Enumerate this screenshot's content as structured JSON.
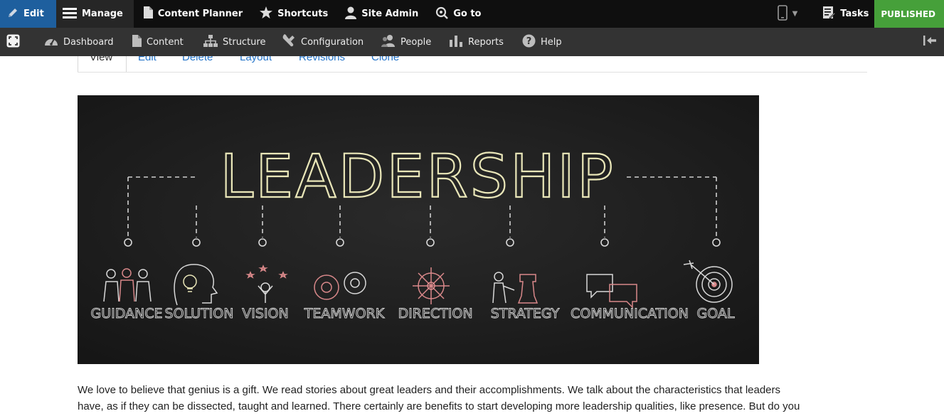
{
  "topbar": {
    "edit": "Edit",
    "manage": "Manage",
    "content_planner": "Content Planner",
    "shortcuts": "Shortcuts",
    "site_admin": "Site Admin",
    "go_to": "Go to",
    "tasks": "Tasks",
    "published": "PUBLISHED"
  },
  "tray": {
    "dashboard": "Dashboard",
    "content": "Content",
    "structure": "Structure",
    "configuration": "Configuration",
    "people": "People",
    "reports": "Reports",
    "help": "Help"
  },
  "tabs": [
    "View",
    "Edit",
    "Delete",
    "Layout",
    "Revisions",
    "Clone"
  ],
  "image": {
    "title": "LEADERSHIP",
    "labels": [
      "GUIDANCE",
      "SOLUTION",
      "VISION",
      "TEAMWORK",
      "DIRECTION",
      "STRATEGY",
      "COMMUNICATION",
      "GOAL"
    ]
  },
  "body": {
    "line1": "We love to believe that genius is a gift. We read stories about great leaders and their accomplishments. We talk about the characteristics that leaders",
    "line2": "have, as if they can be dissected, taught and learned. There certainly are benefits to start developing more leadership qualities, like presence. But do you"
  },
  "colors": {
    "edit_bg": "#1e5f9e",
    "published_bg": "#46a03a",
    "link": "#2474c9",
    "chalk": "#e9e6b8"
  }
}
